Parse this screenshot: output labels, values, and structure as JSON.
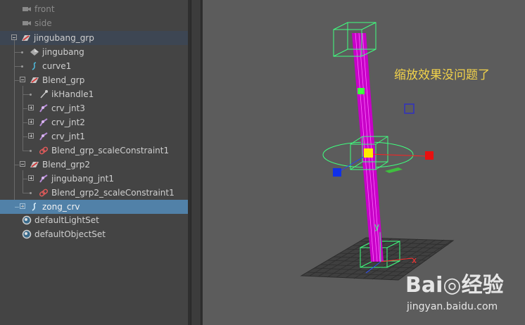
{
  "outliner": {
    "items": [
      {
        "label": "front",
        "icon": "camera-icon"
      },
      {
        "label": "side",
        "icon": "camera-icon"
      },
      {
        "label": "jingubang_grp",
        "icon": "group-icon"
      },
      {
        "label": "jingubang",
        "icon": "mesh-icon"
      },
      {
        "label": "curve1",
        "icon": "curve-icon"
      },
      {
        "label": "Blend_grp",
        "icon": "group-icon"
      },
      {
        "label": "ikHandle1",
        "icon": "ik-handle-icon"
      },
      {
        "label": "crv_jnt3",
        "icon": "joint-icon"
      },
      {
        "label": "crv_jnt2",
        "icon": "joint-icon"
      },
      {
        "label": "crv_jnt1",
        "icon": "joint-icon"
      },
      {
        "label": "Blend_grp_scaleConstraint1",
        "icon": "constraint-icon"
      },
      {
        "label": "Blend_grp2",
        "icon": "group-icon"
      },
      {
        "label": "jingubang_jnt1",
        "icon": "joint-icon"
      },
      {
        "label": "Blend_grp2_scaleConstraint1",
        "icon": "constraint-icon"
      },
      {
        "label": "zong_crv",
        "icon": "curve-icon"
      },
      {
        "label": "defaultLightSet",
        "icon": "set-icon"
      },
      {
        "label": "defaultObjectSet",
        "icon": "set-icon"
      }
    ]
  },
  "viewport": {
    "annotation": "缩放效果没问题了",
    "axis_labels": {
      "y": "y",
      "x": "x"
    },
    "colors": {
      "background": "#5c5c5c",
      "mesh": "#c800c8",
      "control": "#3fff7f",
      "annotation": "#f3d34a"
    }
  },
  "watermark": {
    "logo": "Bai◎经验",
    "url": "jingyan.baidu.com"
  }
}
